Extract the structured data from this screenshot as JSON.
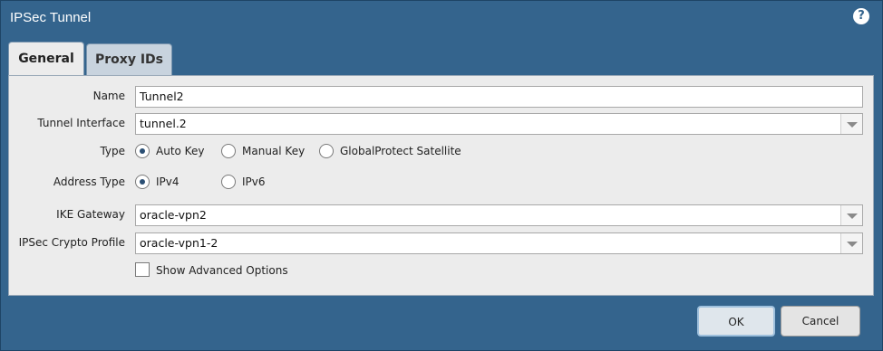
{
  "dialog": {
    "title": "IPSec Tunnel",
    "help_icon": "?"
  },
  "tabs": [
    {
      "label": "General",
      "active": true
    },
    {
      "label": "Proxy IDs",
      "active": false
    }
  ],
  "form": {
    "name": {
      "label": "Name",
      "value": "Tunnel2"
    },
    "tunnel_interface": {
      "label": "Tunnel Interface",
      "value": "tunnel.2"
    },
    "type": {
      "label": "Type",
      "options": [
        {
          "label": "Auto Key",
          "selected": true
        },
        {
          "label": "Manual Key",
          "selected": false
        },
        {
          "label": "GlobalProtect Satellite",
          "selected": false
        }
      ]
    },
    "address_type": {
      "label": "Address Type",
      "options": [
        {
          "label": "IPv4",
          "selected": true
        },
        {
          "label": "IPv6",
          "selected": false
        }
      ]
    },
    "ike_gateway": {
      "label": "IKE Gateway",
      "value": "oracle-vpn2"
    },
    "crypto_profile": {
      "label": "IPSec Crypto Profile",
      "value": "oracle-vpn1-2"
    },
    "advanced": {
      "label": "Show Advanced Options",
      "checked": false
    }
  },
  "buttons": {
    "ok": "OK",
    "cancel": "Cancel"
  },
  "colors": {
    "dialog_bg": "#34648d",
    "panel_bg": "#ececec",
    "radio_dot": "#2b4f74"
  }
}
